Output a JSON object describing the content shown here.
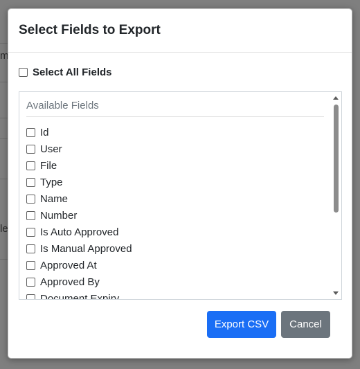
{
  "background": {
    "fragments": [
      "m",
      "le"
    ]
  },
  "modal": {
    "title": "Select Fields to Export",
    "select_all_label": "Select All Fields",
    "list_header": "Available Fields",
    "fields": [
      "Id",
      "User",
      "File",
      "Type",
      "Name",
      "Number",
      "Is Auto Approved",
      "Is Manual Approved",
      "Approved At",
      "Approved By",
      "Document Expiry"
    ],
    "export_label": "Export CSV",
    "cancel_label": "Cancel"
  },
  "colors": {
    "primary": "#1a6ef5",
    "secondary": "#6c757d"
  }
}
